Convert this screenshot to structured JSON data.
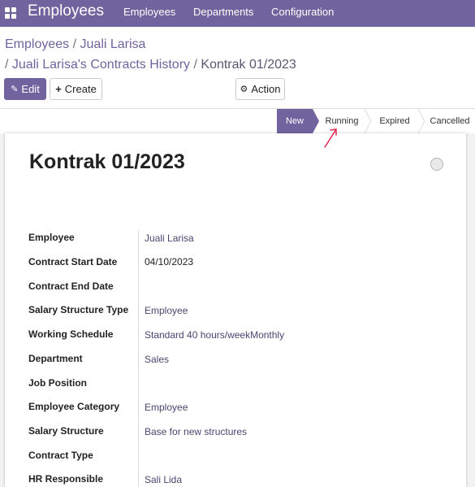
{
  "navbar": {
    "app_title": "Employees",
    "menu": [
      "Employees",
      "Departments",
      "Configuration"
    ]
  },
  "breadcrumb": {
    "line1": [
      "Employees",
      "Juali Larisa"
    ],
    "line2": [
      "Juali Larisa's Contracts History"
    ],
    "current": "Kontrak 01/2023",
    "separator": "/"
  },
  "toolbar": {
    "edit_label": "Edit",
    "create_label": "Create",
    "action_label": "Action"
  },
  "status": {
    "stages": [
      "New",
      "Running",
      "Expired",
      "Cancelled"
    ],
    "current": "New"
  },
  "record": {
    "title": "Kontrak 01/2023"
  },
  "fields": [
    {
      "label": "Employee",
      "value": "Juali Larisa"
    },
    {
      "label": "Contract Start Date",
      "value": "04/10/2023"
    },
    {
      "label": "Contract End Date",
      "value": ""
    },
    {
      "label": "Salary Structure Type",
      "value": "Employee"
    },
    {
      "label": "Working Schedule",
      "value": "Standard 40 hours/weekMonthly"
    },
    {
      "label": "Department",
      "value": "Sales"
    },
    {
      "label": "Job Position",
      "value": ""
    },
    {
      "label": "Employee Category",
      "value": "Employee"
    },
    {
      "label": "Salary Structure",
      "value": "Base for new structures"
    },
    {
      "label": "Contract Type",
      "value": ""
    },
    {
      "label": "HR Responsible",
      "value": "Sali Lida"
    }
  ],
  "colors": {
    "brand": "#71639e",
    "link": "#4d4470",
    "annotation": "#e0284f"
  }
}
